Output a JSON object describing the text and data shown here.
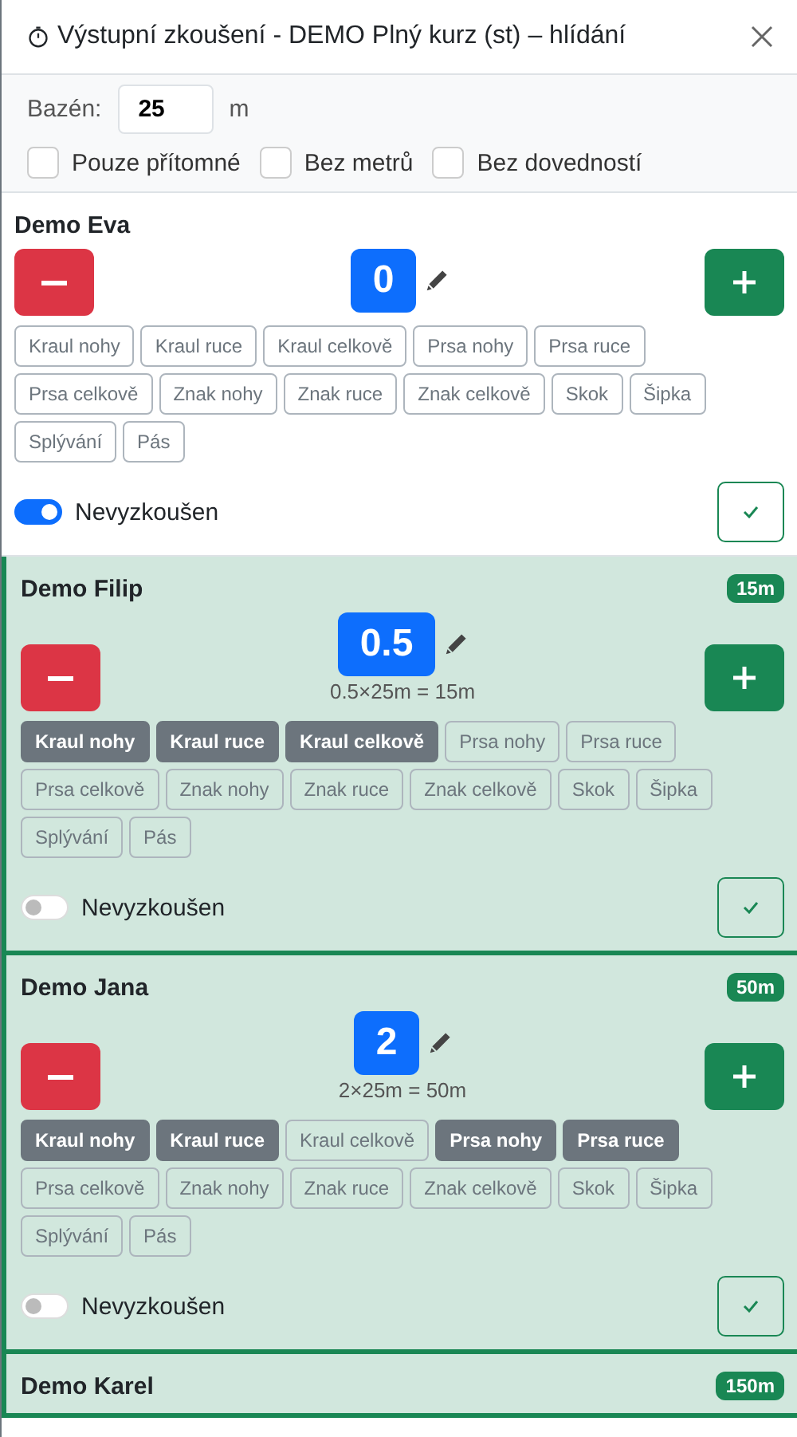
{
  "window": {
    "title": "Výstupní zkoušení - DEMO Plný kurz (st) – hlídání"
  },
  "pool": {
    "label": "Bazén:",
    "value": "25",
    "unit": "m"
  },
  "filters": [
    {
      "label": "Pouze přítomné",
      "checked": false
    },
    {
      "label": "Bez metrů",
      "checked": false
    },
    {
      "label": "Bez dovedností",
      "checked": false
    }
  ],
  "students": [
    {
      "name": "Demo Eva",
      "count": "0",
      "untested": true,
      "toggle_label": "Nevyzkoušen",
      "skills": [
        {
          "label": "Kraul nohy",
          "selected": false
        },
        {
          "label": "Kraul ruce",
          "selected": false
        },
        {
          "label": "Kraul celkově",
          "selected": false
        },
        {
          "label": "Prsa nohy",
          "selected": false
        },
        {
          "label": "Prsa ruce",
          "selected": false
        },
        {
          "label": "Prsa celkově",
          "selected": false
        },
        {
          "label": "Znak nohy",
          "selected": false
        },
        {
          "label": "Znak ruce",
          "selected": false
        },
        {
          "label": "Znak celkově",
          "selected": false
        },
        {
          "label": "Skok",
          "selected": false
        },
        {
          "label": "Šipka",
          "selected": false
        },
        {
          "label": "Splývání",
          "selected": false
        },
        {
          "label": "Pás",
          "selected": false
        }
      ]
    },
    {
      "name": "Demo Filip",
      "badge": "15m",
      "count": "0.5",
      "formula": "0.5×25m = 15m",
      "untested": false,
      "toggle_label": "Nevyzkoušen",
      "skills": [
        {
          "label": "Kraul nohy",
          "selected": true
        },
        {
          "label": "Kraul ruce",
          "selected": true
        },
        {
          "label": "Kraul celkově",
          "selected": true
        },
        {
          "label": "Prsa nohy",
          "selected": false
        },
        {
          "label": "Prsa ruce",
          "selected": false
        },
        {
          "label": "Prsa celkově",
          "selected": false
        },
        {
          "label": "Znak nohy",
          "selected": false
        },
        {
          "label": "Znak ruce",
          "selected": false
        },
        {
          "label": "Znak celkově",
          "selected": false
        },
        {
          "label": "Skok",
          "selected": false
        },
        {
          "label": "Šipka",
          "selected": false
        },
        {
          "label": "Splývání",
          "selected": false
        },
        {
          "label": "Pás",
          "selected": false
        }
      ]
    },
    {
      "name": "Demo Jana",
      "badge": "50m",
      "count": "2",
      "formula": "2×25m = 50m",
      "untested": false,
      "toggle_label": "Nevyzkoušen",
      "skills": [
        {
          "label": "Kraul nohy",
          "selected": true
        },
        {
          "label": "Kraul ruce",
          "selected": true
        },
        {
          "label": "Kraul celkově",
          "selected": false
        },
        {
          "label": "Prsa nohy",
          "selected": true
        },
        {
          "label": "Prsa ruce",
          "selected": true
        },
        {
          "label": "Prsa celkově",
          "selected": false
        },
        {
          "label": "Znak nohy",
          "selected": false
        },
        {
          "label": "Znak ruce",
          "selected": false
        },
        {
          "label": "Znak celkově",
          "selected": false
        },
        {
          "label": "Skok",
          "selected": false
        },
        {
          "label": "Šipka",
          "selected": false
        },
        {
          "label": "Splývání",
          "selected": false
        },
        {
          "label": "Pás",
          "selected": false
        }
      ]
    },
    {
      "name": "Demo Karel",
      "badge": "150m"
    }
  ]
}
